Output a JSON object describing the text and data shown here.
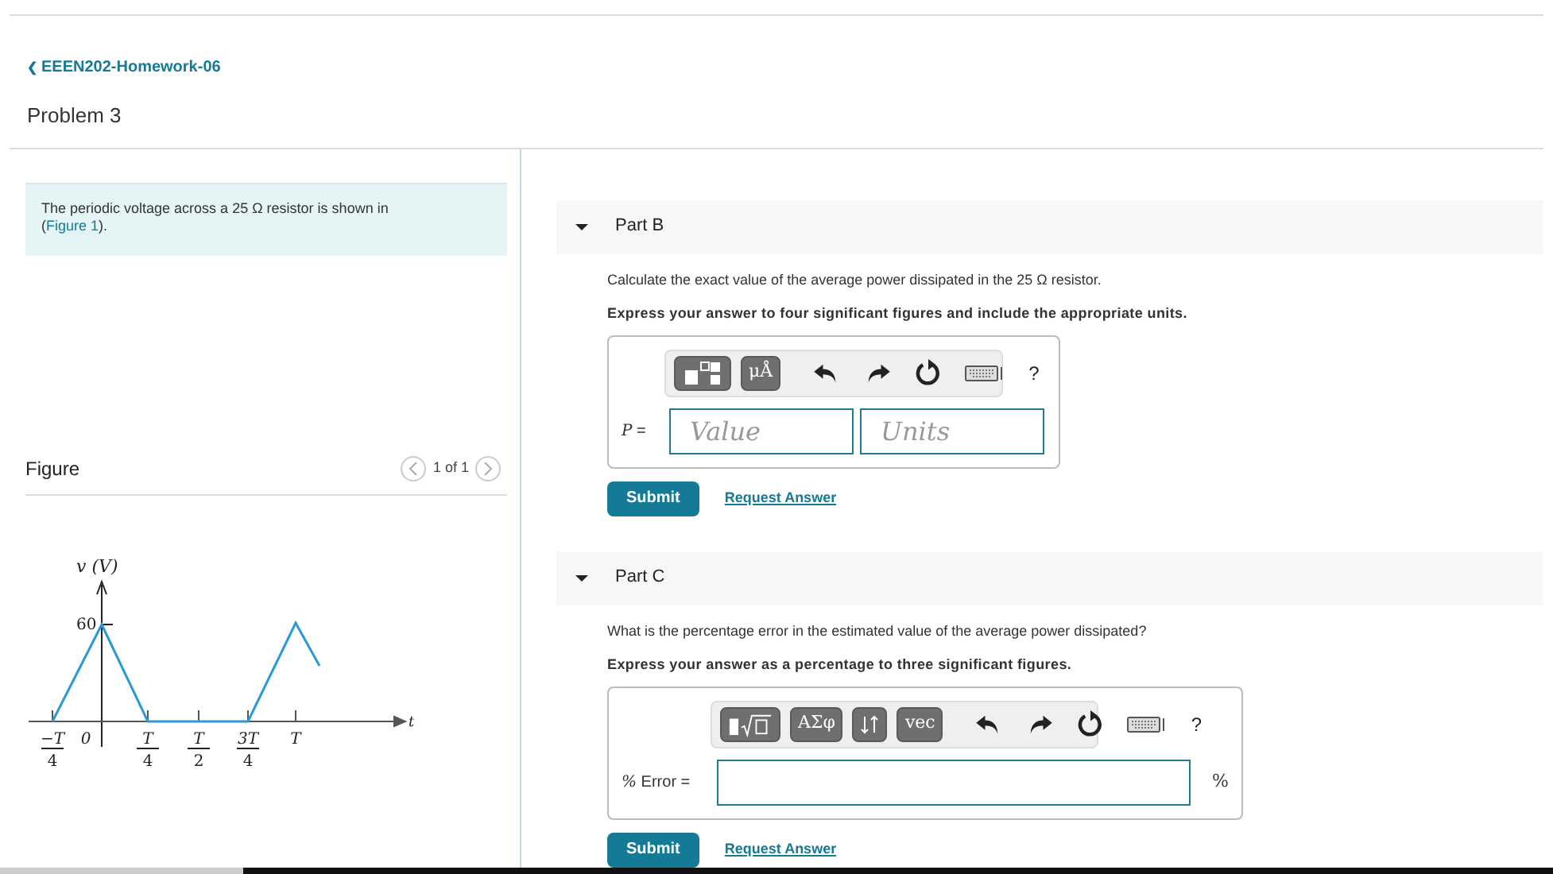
{
  "breadcrumb": {
    "back_icon": "❮",
    "label": "EEEN202-Homework-06"
  },
  "title": "Problem 3",
  "intro": {
    "text": "The periodic voltage across a 25 Ω resistor is shown in",
    "link": "Figure 1",
    "open": "(",
    "close": ")."
  },
  "figure": {
    "heading": "Figure",
    "pager": "1 of 1",
    "ylabel": "v (V)",
    "peak": "60",
    "xvar": "t",
    "xticks": [
      {
        "num": "−T",
        "den": "4"
      },
      {
        "num": "0"
      },
      {
        "num": "T",
        "den": "4"
      },
      {
        "num": "T",
        "den": "2"
      },
      {
        "num": "3T",
        "den": "4"
      },
      {
        "num": "T"
      }
    ]
  },
  "parts": [
    {
      "title": "Part B",
      "expanded": true,
      "question": "Calculate the exact value of the average power dissipated in the 25 Ω resistor.",
      "instruction": "Express your answer to four significant figures and include the appropriate units.",
      "kind": "value-units",
      "var": "P",
      "eq": "=",
      "fields": [
        {
          "placeholder": "Value"
        },
        {
          "placeholder": "Units"
        }
      ],
      "tools": [
        {
          "kind": "templates"
        },
        {
          "kind": "text",
          "label": "μÅ"
        }
      ],
      "help": "?",
      "submit": "Submit",
      "request": "Request Answer"
    },
    {
      "title": "Part C",
      "expanded": true,
      "question": "What is the percentage error in the estimated value of the average power dissipated?",
      "instruction": "Express your answer as a percentage to three significant figures.",
      "kind": "single",
      "var": "%",
      "eq": "Error =",
      "unit_suffix": "%",
      "tools": [
        {
          "kind": "root"
        },
        {
          "kind": "text",
          "label": "ΑΣφ"
        },
        {
          "kind": "arrows"
        },
        {
          "kind": "text",
          "label": "vec"
        }
      ],
      "help": "?",
      "submit": "Submit",
      "request": "Request Answer"
    }
  ]
}
